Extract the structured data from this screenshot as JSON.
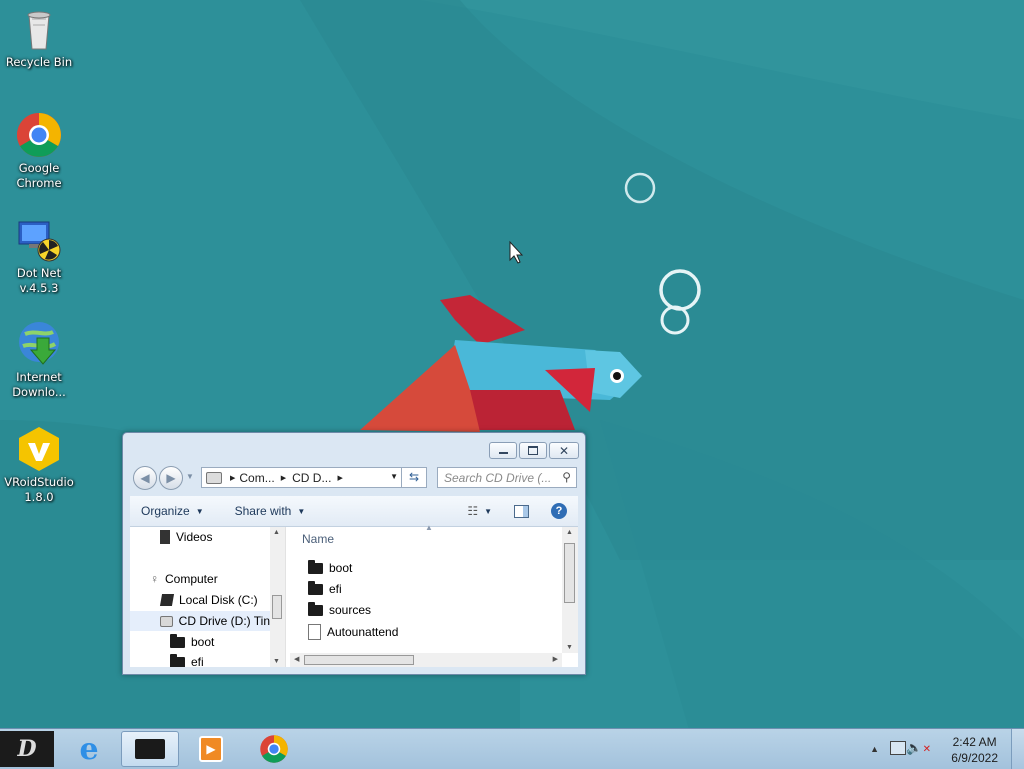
{
  "desktop": {
    "icons": [
      {
        "name": "recycle-bin",
        "label": "Recycle Bin"
      },
      {
        "name": "google-chrome",
        "label": "Google\nChrome"
      },
      {
        "name": "dot-net",
        "label": "Dot Net\nv.4.5.3"
      },
      {
        "name": "internet-download-manager",
        "label": "Internet\nDownlo..."
      },
      {
        "name": "vroid-studio",
        "label": "VRoidStudio\n1.8.0"
      }
    ]
  },
  "explorer": {
    "address": {
      "seg1": "Com...",
      "seg2": "CD D..."
    },
    "search_placeholder": "Search CD Drive (...",
    "toolbar": {
      "organize": "Organize",
      "share_with": "Share with"
    },
    "nav_tree": [
      {
        "label": "Videos"
      },
      {
        "label": "Computer"
      },
      {
        "label": "Local Disk (C:)"
      },
      {
        "label": "CD Drive (D:) Tin"
      },
      {
        "label": "boot"
      },
      {
        "label": "efi"
      }
    ],
    "column_header": "Name",
    "files": [
      {
        "label": "boot",
        "type": "folder"
      },
      {
        "label": "efi",
        "type": "folder"
      },
      {
        "label": "sources",
        "type": "folder"
      },
      {
        "label": "Autounattend",
        "type": "file"
      }
    ]
  },
  "taskbar": {
    "clock": {
      "time": "2:42 AM",
      "date": "6/9/2022"
    },
    "pinned": [
      "start-button",
      "internet-explorer",
      "file-explorer",
      "media-player",
      "google-chrome"
    ]
  },
  "colors": {
    "wallpaper": "#2c8f98",
    "fish_body": "#4ab8d8",
    "fish_fin": "#c42637"
  }
}
